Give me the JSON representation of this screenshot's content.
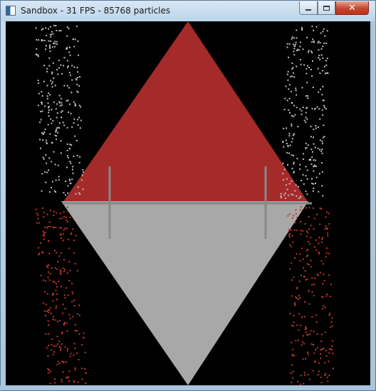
{
  "window": {
    "title": "Sandbox - 31 FPS - 85768 particles",
    "app_icon": "window-app-icon",
    "controls": {
      "minimize": {
        "icon": "minimize-icon"
      },
      "maximize": {
        "icon": "maximize-icon"
      },
      "close": {
        "icon": "close-icon",
        "glyph": "✕"
      }
    }
  },
  "simulation": {
    "background_color": "#000000",
    "colors": {
      "upper_material": "#a52a2a",
      "lower_material": "#a8a8a8",
      "falling_left_top": "#bfbfbf",
      "falling_bottom": "#c0392b",
      "wall": "#888888"
    }
  }
}
